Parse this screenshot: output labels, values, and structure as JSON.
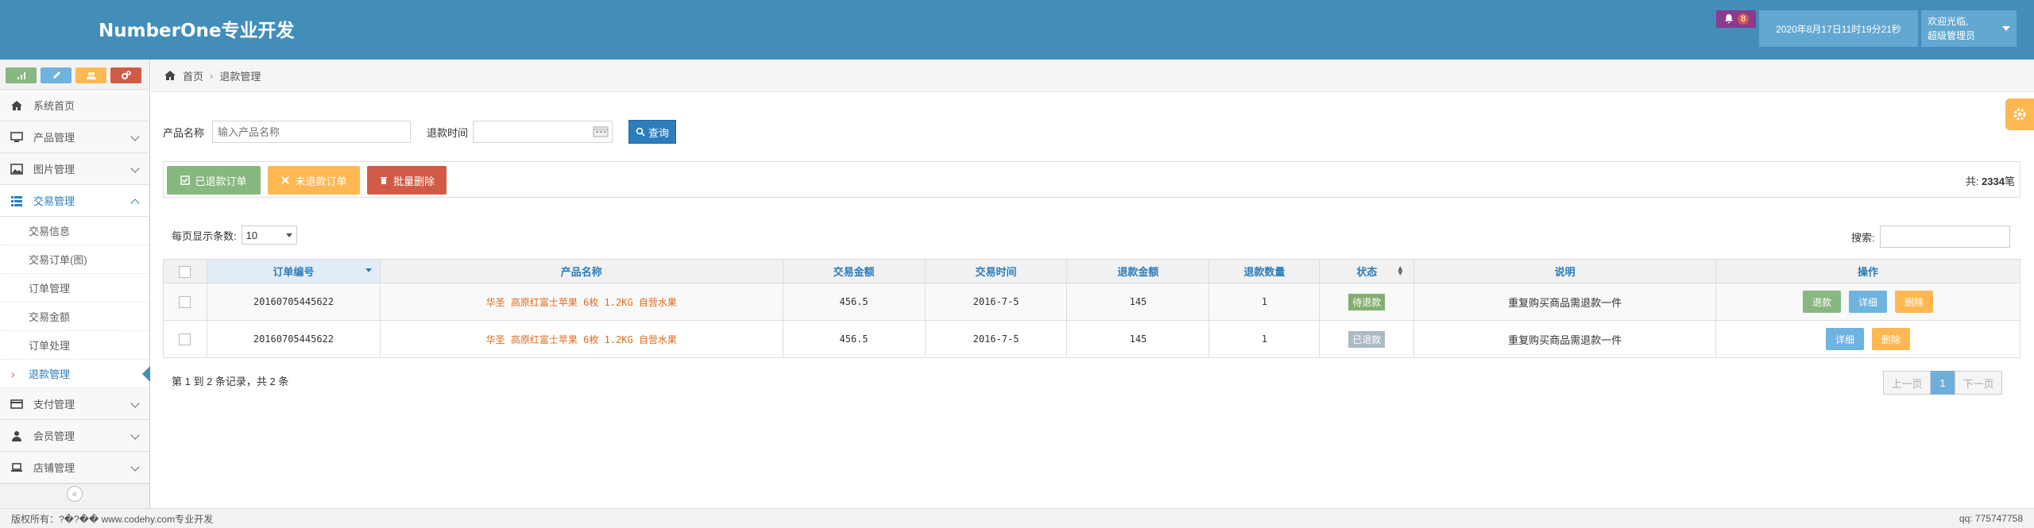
{
  "header": {
    "brand": "NumberOne专业开发",
    "notification_count": "8",
    "datetime": "2020年8月17日11时19分21秒",
    "welcome": "欢迎光临,",
    "role": "超级管理员"
  },
  "colors": {
    "header_bg": "#438eb9",
    "success": "#87b87f",
    "warning": "#ffb752",
    "danger": "#d15b47",
    "info": "#6fb3e0",
    "primary": "#2b7dbc",
    "pending": "#82af6f",
    "muted": "#abbac3"
  },
  "shortcuts": [
    "signal-icon",
    "pencil-icon",
    "users-icon",
    "cogs-icon"
  ],
  "sidebar": {
    "items": [
      {
        "label": "系统首页",
        "icon": "home-icon"
      },
      {
        "label": "产品管理",
        "icon": "desktop-icon"
      },
      {
        "label": "图片管理",
        "icon": "picture-icon"
      },
      {
        "label": "交易管理",
        "icon": "list-icon"
      }
    ],
    "sub_items": [
      "交易信息",
      "交易订单(图)",
      "订单管理",
      "交易金额",
      "订单处理",
      "退款管理"
    ],
    "bottom_items": [
      {
        "label": "支付管理",
        "icon": "credit-card-icon"
      },
      {
        "label": "会员管理",
        "icon": "user-icon"
      },
      {
        "label": "店铺管理",
        "icon": "laptop-icon"
      }
    ]
  },
  "breadcrumb": {
    "home": "首页",
    "current": "退款管理"
  },
  "search": {
    "name_label": "产品名称",
    "name_placeholder": "输入产品名称",
    "time_label": "退款时间",
    "query_button": "查询"
  },
  "actions": {
    "refunded": "已退款订单",
    "unrefunded": "未退款订单",
    "batch_delete": "批量删除",
    "total_prefix": "共:",
    "total_count": "2334",
    "total_suffix": "笔"
  },
  "table_controls": {
    "page_len_label": "每页显示条数:",
    "page_len_value": "10",
    "search_label": "搜索:"
  },
  "table": {
    "headers": [
      "订单编号",
      "产品名称",
      "交易金额",
      "交易时间",
      "退款金额",
      "退款数量",
      "状态",
      "说明",
      "操作"
    ],
    "rows": [
      {
        "order_no": "20160705445622",
        "product": "华圣 高原红富士苹果 6枚 1.2KG 自营水果",
        "amount": "456.5",
        "time": "2016-7-5",
        "refund_amount": "145",
        "refund_qty": "1",
        "status": "待退款",
        "note": "重复购买商品需退款一件",
        "ops": [
          "退款",
          "详细",
          "删除"
        ]
      },
      {
        "order_no": "20160705445622",
        "product": "华圣 高原红富士苹果 6枚 1.2KG 自营水果",
        "amount": "456.5",
        "time": "2016-7-5",
        "refund_amount": "145",
        "refund_qty": "1",
        "status": "已退款",
        "note": "重复购买商品需退款一件",
        "ops": [
          "详细",
          "删除"
        ]
      }
    ]
  },
  "pagination": {
    "info": "第 1 到 2 条记录，共 2 条",
    "prev": "上一页",
    "current": "1",
    "next": "下一页"
  },
  "footer": {
    "copyright": "版权所有：?�?�� www.codehy.com专业开发",
    "qq": "qq: 775747758"
  }
}
